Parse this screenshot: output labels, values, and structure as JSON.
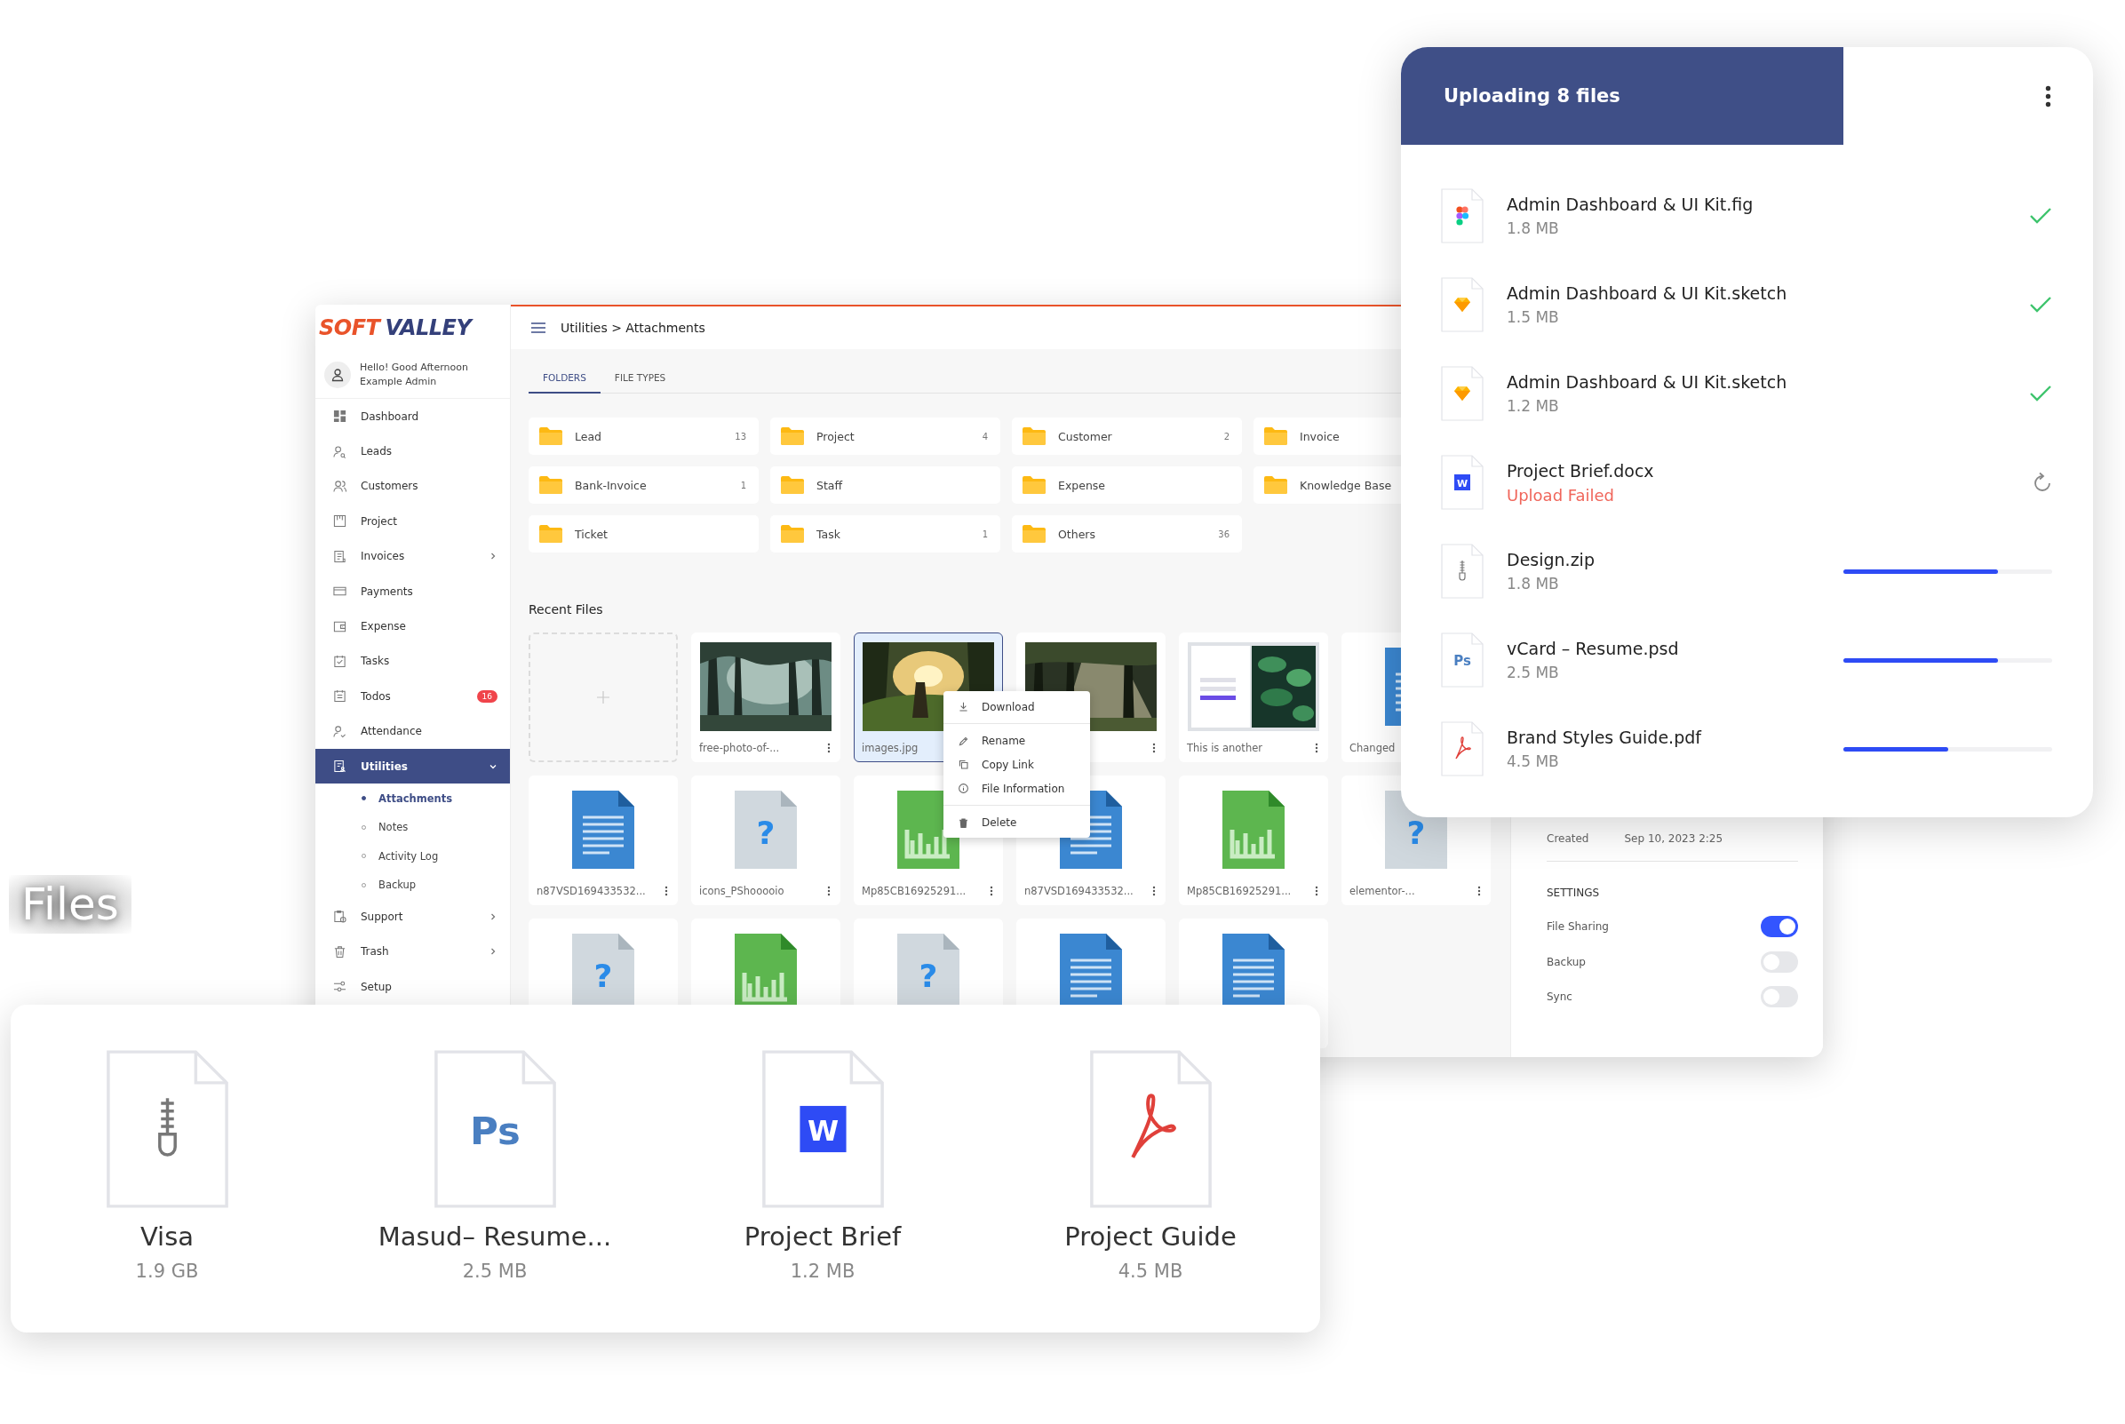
{
  "background_title": "Files",
  "app": {
    "logo": [
      "SOFT",
      "VALLEY"
    ],
    "user": {
      "greeting": "Hello! Good Afternoon",
      "name": "Example Admin"
    },
    "nav": [
      {
        "label": "Dashboard",
        "selected": false
      },
      {
        "label": "Leads",
        "selected": false
      },
      {
        "label": "Customers",
        "selected": false
      },
      {
        "label": "Project",
        "selected": false
      },
      {
        "label": "Invoices",
        "selected": false,
        "expanded": false
      },
      {
        "label": "Payments",
        "selected": false
      },
      {
        "label": "Expense",
        "selected": false
      },
      {
        "label": "Tasks",
        "selected": false
      },
      {
        "label": "Todos",
        "selected": false,
        "badge": "16"
      },
      {
        "label": "Attendance",
        "selected": false
      },
      {
        "label": "Utilities",
        "selected": true,
        "expanded": true,
        "children": [
          {
            "label": "Attachments",
            "selected": true
          },
          {
            "label": "Notes",
            "selected": false
          },
          {
            "label": "Activity Log",
            "selected": false
          },
          {
            "label": "Backup",
            "selected": false
          }
        ]
      },
      {
        "label": "Support",
        "selected": false,
        "expanded": false
      },
      {
        "label": "Trash",
        "selected": false,
        "expanded": false
      },
      {
        "label": "Setup",
        "selected": false
      }
    ],
    "breadcrumb": "Utilities > Attachments",
    "tabs": [
      {
        "label": "FOLDERS",
        "selected": true
      },
      {
        "label": "FILE TYPES",
        "selected": false
      }
    ],
    "folders": [
      {
        "name": "Lead",
        "count": "13"
      },
      {
        "name": "Project",
        "count": "4"
      },
      {
        "name": "Customer",
        "count": "2"
      },
      {
        "name": "Invoice"
      },
      {
        "name": "Bank-Invoice",
        "count": "1"
      },
      {
        "name": "Staff"
      },
      {
        "name": "Expense"
      },
      {
        "name": "Knowledge Base"
      },
      {
        "name": "Ticket"
      },
      {
        "name": "Task",
        "count": "1"
      },
      {
        "name": "Others",
        "count": "36"
      }
    ],
    "recent_title": "Recent Files",
    "recent_files": [
      {
        "kind": "upload"
      },
      {
        "kind": "picture",
        "name": "free-photo-of-...",
        "selected": false,
        "menu_button": true
      },
      {
        "kind": "picture",
        "name": "images.jpg",
        "selected": true
      },
      {
        "kind": "picture",
        "selected": false,
        "menu_button": true
      },
      {
        "kind": "picture",
        "name": "This is another",
        "selected": false,
        "menu_button": true
      },
      {
        "kind": "doc",
        "name": "Changed",
        "selected": false
      },
      {
        "kind": "doc",
        "name": "n87VSD169433532...",
        "selected": false,
        "menu_button": true
      },
      {
        "kind": "unknown",
        "mark": "?",
        "name": "icons_PShooooio",
        "selected": false,
        "menu_button": true
      },
      {
        "kind": "sheet",
        "name": "Mp85CB16925291...",
        "selected": false,
        "menu_button": true
      },
      {
        "kind": "doc",
        "name": "n87VSD169433532...",
        "selected": false,
        "menu_button": true
      },
      {
        "kind": "sheet",
        "name": "Mp85CB16925291...",
        "selected": false,
        "menu_button": true
      },
      {
        "kind": "unknown",
        "mark": "?",
        "name": "elementor-...",
        "selected": false,
        "menu_button": true
      },
      {
        "kind": "unknown",
        "mark": "?",
        "selected": false
      },
      {
        "kind": "sheet",
        "selected": false
      },
      {
        "kind": "unknown",
        "mark": "?",
        "selected": false
      },
      {
        "kind": "doc",
        "selected": false
      },
      {
        "kind": "doc",
        "selected": false
      }
    ],
    "context_menu": [
      {
        "label": "Download",
        "divider_before": false
      },
      {
        "label": "Rename",
        "divider_before": true
      },
      {
        "label": "Copy Link",
        "divider_before": false
      },
      {
        "label": "File Information",
        "divider_before": false
      },
      {
        "label": "Delete",
        "divider_before": true
      }
    ],
    "details": {
      "created_label": "Created",
      "created_value": "Sep 10, 2023 2:25",
      "settings_title": "SETTINGS",
      "settings": [
        {
          "label": "File Sharing",
          "on": true
        },
        {
          "label": "Backup",
          "on": false
        },
        {
          "label": "Sync",
          "on": false
        }
      ]
    }
  },
  "upload": {
    "title": "Uploading 8 files",
    "files": [
      {
        "kind": "fig",
        "name": "Admin Dashboard & UI Kit.fig",
        "size": "1.8 MB",
        "done": true
      },
      {
        "kind": "sketch",
        "name": "Admin Dashboard & UI Kit.sketch",
        "size": "1.5 MB",
        "done": true
      },
      {
        "kind": "sketch",
        "name": "Admin Dashboard & UI Kit.sketch",
        "size": "1.2 MB",
        "done": true
      },
      {
        "kind": "docx",
        "badge": "W",
        "name": "Project Brief.docx",
        "error": "Upload Failed"
      },
      {
        "kind": "zip",
        "name": "Design.zip",
        "size": "1.8 MB",
        "level": 0.74
      },
      {
        "kind": "psd",
        "badge": "Ps",
        "name": "vCard – Resume.psd",
        "size": "2.5 MB",
        "level": 0.74
      },
      {
        "kind": "pdf",
        "name": "Brand Styles Guide.pdf",
        "size": "4.5 MB",
        "level": 0.5
      }
    ]
  },
  "files": [
    {
      "kind": "zip",
      "name": "Visa",
      "size": "1.9 GB"
    },
    {
      "kind": "psd",
      "badge": "Ps",
      "name": "Masud– Resume...",
      "size": "2.5 MB"
    },
    {
      "kind": "docx",
      "badge": "W",
      "name": "Project Brief",
      "size": "1.2 MB"
    },
    {
      "kind": "pdf",
      "name": "Project Guide",
      "size": "4.5 MB"
    }
  ]
}
